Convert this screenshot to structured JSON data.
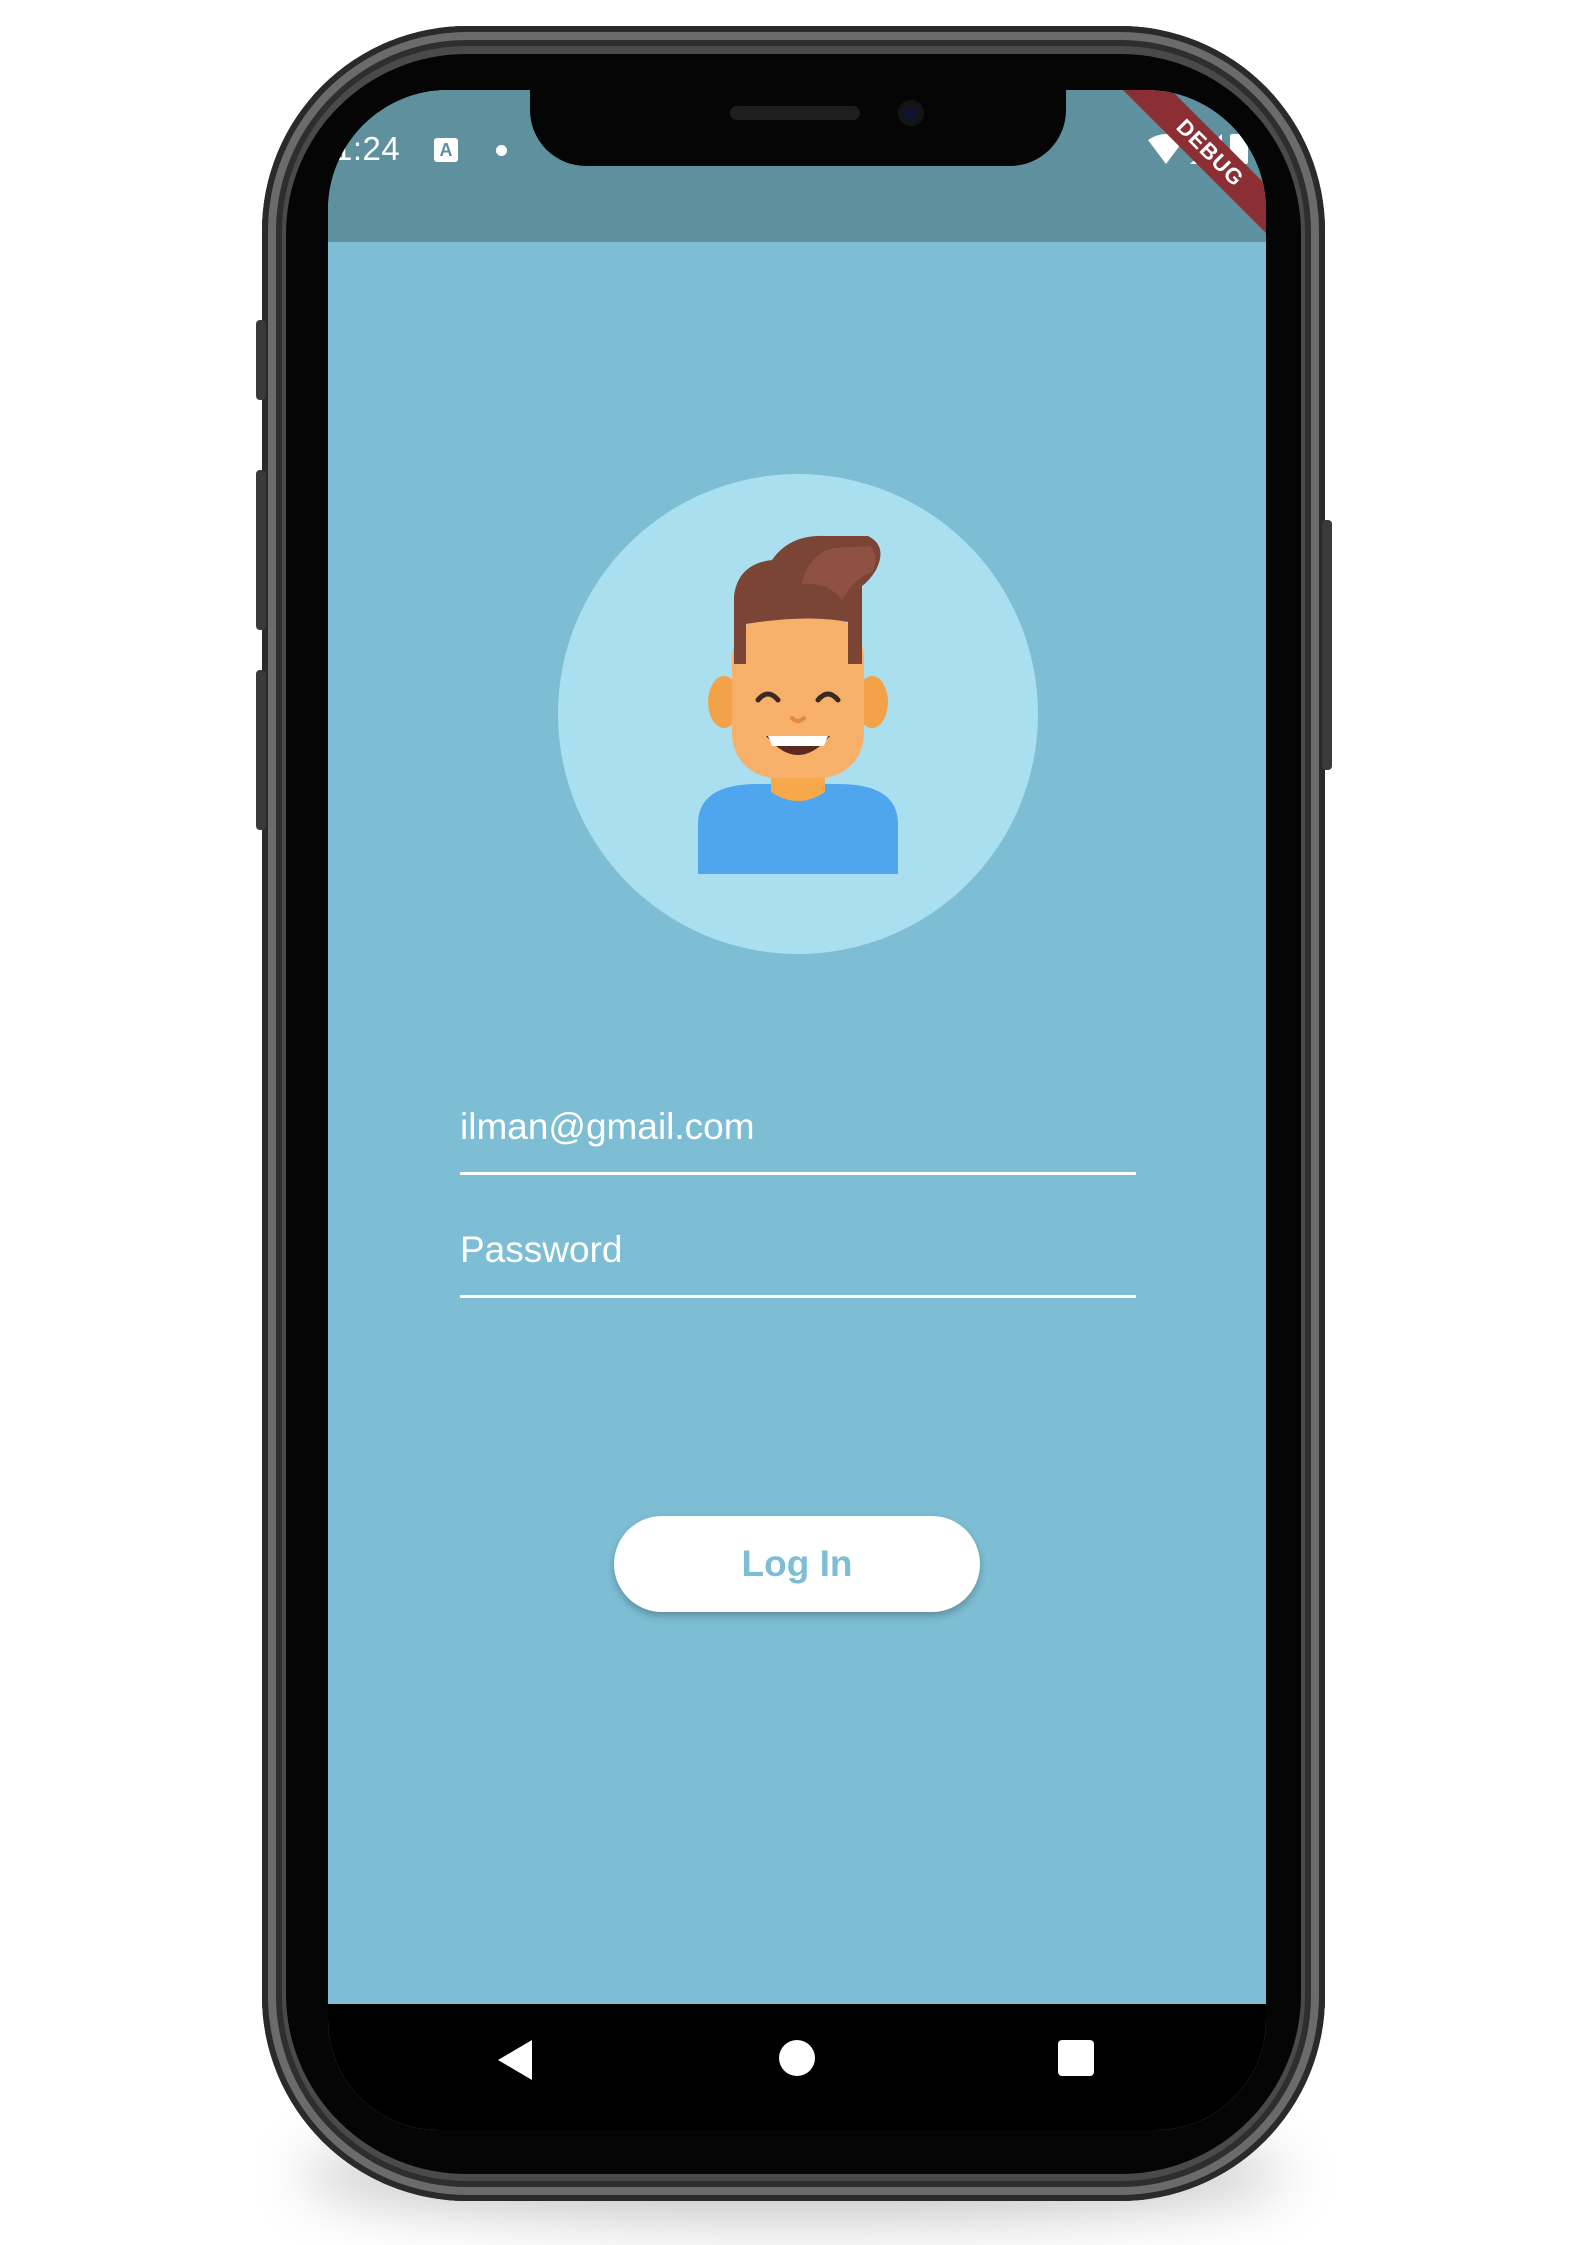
{
  "status_bar": {
    "time": "1:24",
    "notification_icon": "A",
    "debug_banner": "DEBUG"
  },
  "login": {
    "email_value": "ilman@gmail.com",
    "password_placeholder": "Password",
    "login_label": "Log In"
  },
  "colors": {
    "background": "#7dbed4",
    "status_bar": "#5f909e",
    "avatar_circle": "#aadff0",
    "button": "#ffffff",
    "button_text": "#7dbed4",
    "debug_banner": "#8b2f35"
  },
  "icons": {
    "avatar": "smiling-man-avatar-icon",
    "wifi": "wifi-icon",
    "signal": "cell-signal-icon",
    "battery": "battery-icon",
    "back": "back-triangle-icon",
    "home": "home-circle-icon",
    "recents": "recents-square-icon"
  }
}
